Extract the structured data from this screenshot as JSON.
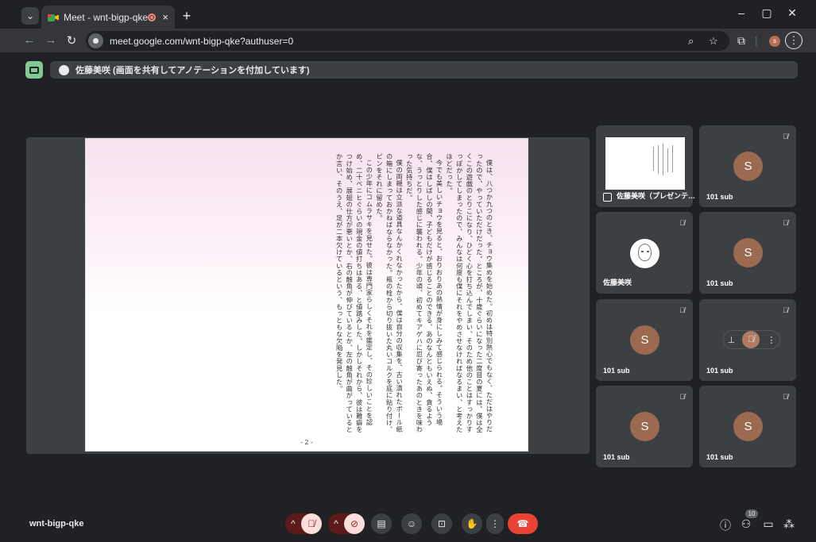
{
  "browser": {
    "tab_title": "Meet - wnt-bigp-qke",
    "tab_close": "×",
    "new_tab": "+",
    "url": "meet.google.com/wnt-bigp-qke?authuser=0",
    "profile_initial": "s",
    "minimize": "–",
    "maximize": "▢",
    "close": "✕"
  },
  "meet": {
    "presenter_banner": "佐藤美咲 (画面を共有してアノテーションを付加しています)",
    "meeting_code": "wnt-bigp-qke",
    "participants_count": "10",
    "document": {
      "page_number": "- 2 -",
      "paragraphs": [
        "僕は、八つか九つのとき、チョウ集めを始めた。初めは特別熱心でもなく、ただはやりだったので、やっていただけだった。ところが、十歳ぐらいになった二度目の夏には、僕は全くこの遊戯のとりこになり、ひどく心を打ち込んでしまい、そのため他のことはすっかりすっぽかしてしまったので、みんなは何度も僕にそれをやめさせなければなるまい、と考えたほどだった。",
        "今でも美しいチョウを見ると、おりおりあの熱情が身にしみて感じられる。そういう場合、僕はしばしの間、子どもだけが感じることのできる、あのなんともいえぬ、貪るような、うっとりした感じに襲われる。少年の頃、初めてキアゲハに忍び寄ったあのときを味わった気持ちだ。",
        "僕の両親は立派な道具なんかくれなかったから、僕は自分の収集を、古い潰れたボール紙の箱にしまっておかねばならなかった。瓶の栓から切り抜いた丸いコルクを底に貼り付け、ピンをそれに留めた。",
        "この少年にコムラサキを見せた。彼は専門家らしくそれを鑑定し、その珍しいことを認め、二十ペニヒぐらいの現金の値打ちはある、と値踏みした。しかしそれから、彼は難癖をつけ始め、展翅の仕方が悪いとか、右の触角が伸びているとか、左の触角が曲がっているとか言い、そのうえ、足が二本欠けているという、もっともな欠陥を発見した。"
      ]
    },
    "tiles": [
      {
        "name": "佐藤美咲（プレゼンテ…"
      },
      {
        "name": "101 sub",
        "initial": "S"
      },
      {
        "name": "佐藤美咲"
      },
      {
        "name": "101 sub",
        "initial": "S"
      },
      {
        "name": "101 sub",
        "initial": "S"
      },
      {
        "name": "101 sub",
        "initial": "S"
      },
      {
        "name": "101 sub",
        "initial": "S"
      },
      {
        "name": "101 sub",
        "initial": "S"
      }
    ]
  }
}
